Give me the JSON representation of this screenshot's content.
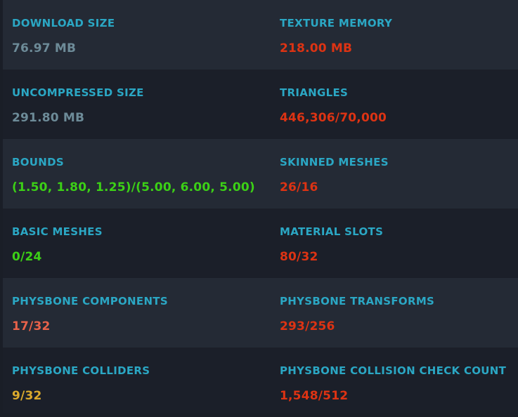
{
  "colors": {
    "label": "#2ba7c4",
    "neutral": "#6d8b98",
    "bad": "#dd3313",
    "good": "#3cd016",
    "poor": "#e8624a",
    "medium": "#dcaa2c",
    "row_light": "#242a35",
    "row_dark": "#1b1f29"
  },
  "stats": [
    {
      "label": "DOWNLOAD SIZE",
      "value": "76.97 MB",
      "status": "neutral"
    },
    {
      "label": "TEXTURE MEMORY",
      "value": "218.00 MB",
      "status": "bad"
    },
    {
      "label": "UNCOMPRESSED SIZE",
      "value": "291.80 MB",
      "status": "neutral"
    },
    {
      "label": "TRIANGLES",
      "value": "446,306/70,000",
      "status": "bad"
    },
    {
      "label": "BOUNDS",
      "value": "(1.50, 1.80, 1.25)/(5.00, 6.00, 5.00)",
      "status": "good"
    },
    {
      "label": "SKINNED MESHES",
      "value": "26/16",
      "status": "bad"
    },
    {
      "label": "BASIC MESHES",
      "value": "0/24",
      "status": "good"
    },
    {
      "label": "MATERIAL SLOTS",
      "value": "80/32",
      "status": "bad"
    },
    {
      "label": "PHYSBONE COMPONENTS",
      "value": "17/32",
      "status": "poor"
    },
    {
      "label": "PHYSBONE TRANSFORMS",
      "value": "293/256",
      "status": "bad"
    },
    {
      "label": "PHYSBONE COLLIDERS",
      "value": "9/32",
      "status": "medium"
    },
    {
      "label": "PHYSBONE COLLISION CHECK COUNT",
      "value": "1,548/512",
      "status": "bad"
    }
  ]
}
